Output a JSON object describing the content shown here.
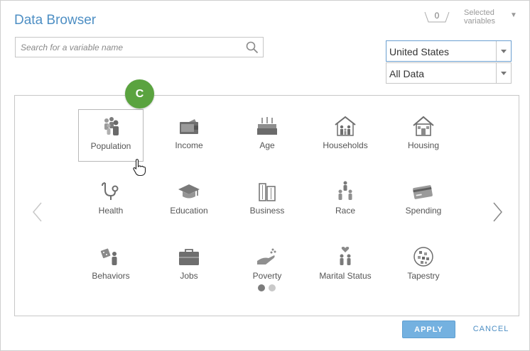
{
  "dialog": {
    "title": "Data Browser"
  },
  "selected": {
    "count": "0",
    "label": "Selected variables"
  },
  "search": {
    "placeholder": "Search for a variable name"
  },
  "country_select": {
    "value": "United States"
  },
  "data_select": {
    "value": "All Data"
  },
  "step_badge": "C",
  "categories": [
    {
      "label": "Population",
      "icon": "population-icon"
    },
    {
      "label": "Income",
      "icon": "wallet-icon"
    },
    {
      "label": "Age",
      "icon": "birthday-cake-icon"
    },
    {
      "label": "Households",
      "icon": "family-house-icon"
    },
    {
      "label": "Housing",
      "icon": "house-icon"
    },
    {
      "label": "Health",
      "icon": "stethoscope-icon"
    },
    {
      "label": "Education",
      "icon": "graduation-cap-icon"
    },
    {
      "label": "Business",
      "icon": "buildings-icon"
    },
    {
      "label": "Race",
      "icon": "people-group-icon"
    },
    {
      "label": "Spending",
      "icon": "credit-card-icon"
    },
    {
      "label": "Behaviors",
      "icon": "dice-person-icon"
    },
    {
      "label": "Jobs",
      "icon": "briefcase-icon"
    },
    {
      "label": "Poverty",
      "icon": "hand-coins-icon"
    },
    {
      "label": "Marital Status",
      "icon": "couple-heart-icon"
    },
    {
      "label": "Tapestry",
      "icon": "tapestry-globe-icon"
    }
  ],
  "pagination": {
    "pages": 2,
    "current": 1
  },
  "footer": {
    "apply": "APPLY",
    "cancel": "CANCEL"
  },
  "colors": {
    "accent": "#4e8fc4",
    "badge": "#5aa33f",
    "apply_bg": "#74b1e0"
  }
}
